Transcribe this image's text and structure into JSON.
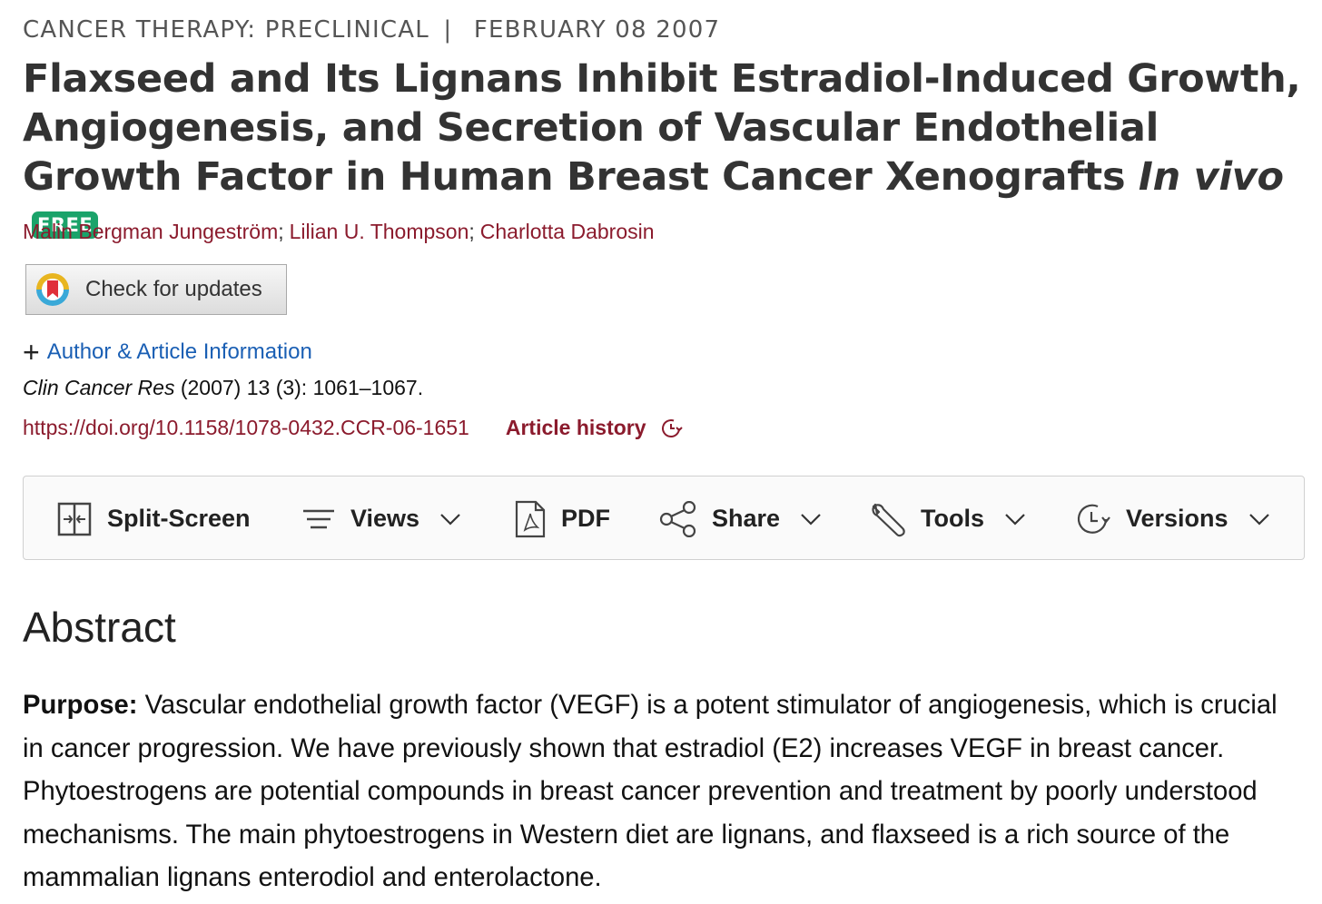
{
  "header": {
    "section": "CANCER THERAPY: PRECLINICAL",
    "separator": "|",
    "date": "FEBRUARY 08 2007"
  },
  "article": {
    "title_main": "Flaxseed and Its Lignans Inhibit Estradiol-Induced Growth, Angiogenesis, and Secretion of Vascular Endothelial Growth Factor in Human Breast Cancer Xenografts ",
    "title_italic": "In vivo",
    "free_badge": "FREE",
    "authors": [
      "Malin Bergman Jungeström",
      "Lilian U. Thompson",
      "Charlotta Dabrosin"
    ],
    "author_separator": ";",
    "check_updates_label": "Check for updates",
    "author_info_label": "Author & Article Information",
    "citation": {
      "journal": "Clin Cancer Res",
      "details": " (2007) 13 (3): 1061–1067."
    },
    "doi": "https://doi.org/10.1158/1078-0432.CCR-06-1651",
    "history_label": "Article history"
  },
  "toolbar": {
    "split_screen": "Split-Screen",
    "views": "Views",
    "pdf": "PDF",
    "share": "Share",
    "tools": "Tools",
    "versions": "Versions"
  },
  "abstract": {
    "heading": "Abstract",
    "purpose_label": "Purpose:",
    "purpose_text": " Vascular endothelial growth factor (VEGF) is a potent stimulator of angiogenesis, which is crucial in cancer progression. We have previously shown that estradiol (E2) increases VEGF in breast cancer. Phytoestrogens are potential compounds in breast cancer prevention and treatment by poorly understood mechanisms. The main phytoestrogens in Western diet are lignans, and flaxseed is a rich source of the mammalian lignans enterodiol and enterolactone."
  },
  "colors": {
    "link_dark_red": "#8b1b2d",
    "link_blue": "#1a5fb4",
    "free_green": "#1aa36a"
  }
}
